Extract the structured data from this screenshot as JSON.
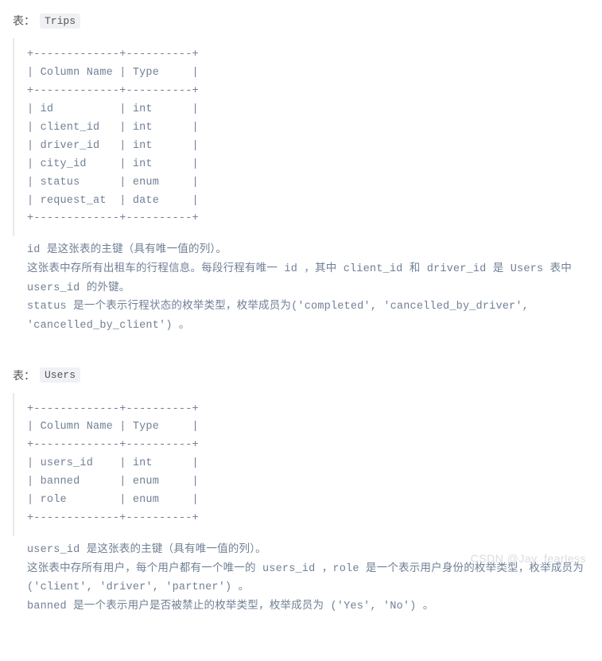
{
  "table1": {
    "label_prefix": "表：",
    "name": "Trips",
    "schema_ascii": "+-------------+----------+\n| Column Name | Type     |\n+-------------+----------+\n| id          | int      |\n| client_id   | int      |\n| driver_id   | int      |\n| city_id     | int      |\n| status      | enum     |\n| request_at  | date     |\n+-------------+----------+",
    "description": "id 是这张表的主键（具有唯一值的列）。\n这张表中存所有出租车的行程信息。每段行程有唯一 id ，其中 client_id 和 driver_id 是 Users 表中 users_id 的外键。\nstatus 是一个表示行程状态的枚举类型，枚举成员为('completed', 'cancelled_by_driver', 'cancelled_by_client') 。"
  },
  "table2": {
    "label_prefix": "表：",
    "name": "Users",
    "schema_ascii": "+-------------+----------+\n| Column Name | Type     |\n+-------------+----------+\n| users_id    | int      |\n| banned      | enum     |\n| role        | enum     |\n+-------------+----------+",
    "description": "users_id 是这张表的主键（具有唯一值的列）。\n这张表中存所有用户，每个用户都有一个唯一的 users_id ，role 是一个表示用户身份的枚举类型，枚举成员为 ('client', 'driver', 'partner') 。\nbanned 是一个表示用户是否被禁止的枚举类型，枚举成员为 ('Yes', 'No') 。"
  },
  "watermark": "CSDN @Jay_fearless"
}
